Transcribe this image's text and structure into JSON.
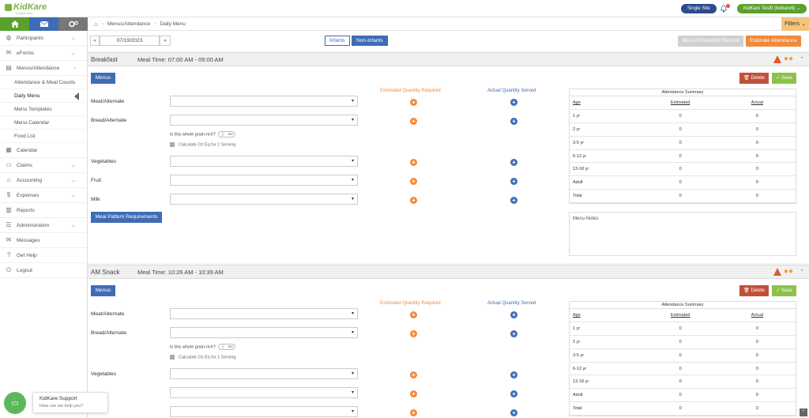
{
  "header": {
    "logo_text": "KidKare",
    "logo_sub": "by Minute Menu",
    "site_button": "Single Site",
    "notification_count": "1",
    "user_button": "KidKare Test9 (kidkare9)"
  },
  "breadcrumb": {
    "home": "⌂",
    "parent": "Menus/Attendance",
    "current": "Daily Menu"
  },
  "filters_label": "Filters",
  "sidebar": {
    "items": [
      {
        "icon": "◍",
        "label": "Participants",
        "chevron": "⌄"
      },
      {
        "icon": "✉",
        "label": "eForms",
        "chevron": "⌄"
      },
      {
        "icon": "▤",
        "label": "Menus/Attendance",
        "chevron": "›"
      }
    ],
    "subitems": [
      "Attendance & Meal Counts",
      "Daily Menu",
      "Menu Templates",
      "Menu Calendar",
      "Food List"
    ],
    "items2": [
      {
        "icon": "▦",
        "label": "Calendar",
        "chevron": ""
      },
      {
        "icon": "▭",
        "label": "Claims",
        "chevron": "⌄"
      },
      {
        "icon": "⌂",
        "label": "Accounting",
        "chevron": "⌄"
      },
      {
        "icon": "$",
        "label": "Expenses",
        "chevron": "⌄"
      },
      {
        "icon": "▥",
        "label": "Reports",
        "chevron": ""
      },
      {
        "icon": "☰",
        "label": "Administration",
        "chevron": "⌄"
      },
      {
        "icon": "✉",
        "label": "Messages",
        "chevron": ""
      },
      {
        "icon": "?",
        "label": "Get Help",
        "chevron": ""
      },
      {
        "icon": "⏻",
        "label": "Logout",
        "chevron": ""
      }
    ]
  },
  "controls": {
    "prev": "«",
    "date": "07/19/2023",
    "next": "»",
    "tab_infants": "Infants",
    "tab_noninfants": "Non-Infants",
    "menu_production_record": "Menu Production Record",
    "estimate_attendance": "Estimate Attendance"
  },
  "labels": {
    "menus": "Menus",
    "est_qty": "Estimated Quantity Required",
    "act_qty": "Actual Quantity Served",
    "grain_rich": "Is this whole grain-rich?",
    "toggle_no": "No",
    "calc_oz": "Calculate Oz Eq for 1 Serving",
    "meal_pattern": "Meal Pattern Requirements",
    "delete": "Delete",
    "save": "Save",
    "summary_title": "Attendance Summary",
    "col_age": "Age",
    "col_estimated": "Estimated",
    "col_actual": "Actual",
    "menu_notes": "Menu Notes"
  },
  "meals": [
    {
      "name": "Breakfast",
      "time": "Meal Time: 07:00 AM - 09:00 AM"
    },
    {
      "name": "AM Snack",
      "time": "Meal Time: 10:26 AM - 10:39 AM"
    }
  ],
  "components": [
    "Meat/Alternate",
    "Bread/Alternate",
    "Vegetables",
    "Fruit",
    "Milk"
  ],
  "attendance": [
    {
      "age": "1 yr",
      "estimated": "0",
      "actual": "0"
    },
    {
      "age": "2 yr",
      "estimated": "0",
      "actual": "0"
    },
    {
      "age": "3-5 yr",
      "estimated": "0",
      "actual": "0"
    },
    {
      "age": "6-12 yr",
      "estimated": "0",
      "actual": "0"
    },
    {
      "age": "13-18 yr",
      "estimated": "0",
      "actual": "0"
    },
    {
      "age": "Adult",
      "estimated": "0",
      "actual": "0"
    },
    {
      "age": "Total",
      "estimated": "0",
      "actual": "0"
    }
  ],
  "chat": {
    "title": "KidKare Support",
    "subtitle": "How can we help you?"
  },
  "colors": {
    "green": "#5aa02c",
    "blue": "#3f6cb5",
    "orange": "#f08a3c",
    "red": "#c0503c"
  }
}
